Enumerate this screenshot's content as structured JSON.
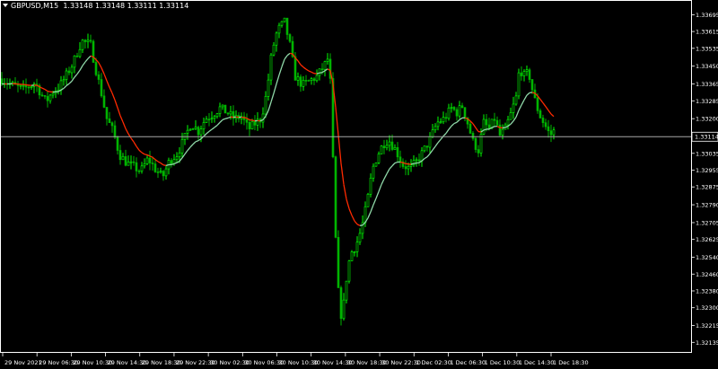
{
  "header": {
    "symbol": "GBPUSD,M15",
    "ohlc": "1.33148 1.33148 1.33111 1.33114"
  },
  "current_price": {
    "label": "1.33114",
    "value": 1.33114
  },
  "colors": {
    "background": "#000000",
    "frame": "#ffffff",
    "bull_candle": "#00ff00",
    "bear_candle": "#00b400",
    "ma_rising": "#8fd8a8",
    "ma_falling": "#ff2a00",
    "price_line": "#a8a8a8"
  },
  "chart_data": {
    "type": "line",
    "title": "",
    "xlabel": "",
    "ylabel": "",
    "ylim": [
      1.32085,
      1.33765
    ],
    "y_ticks": [
      "1.33695",
      "1.33615",
      "1.33535",
      "1.33450",
      "1.33365",
      "1.33285",
      "1.33200",
      "1.33120",
      "1.33035",
      "1.32955",
      "1.32875",
      "1.32790",
      "1.32705",
      "1.32625",
      "1.32540",
      "1.32460",
      "1.32380",
      "1.32300",
      "1.32215",
      "1.32135"
    ],
    "x_ticks": [
      "29 Nov 2021",
      "29 Nov 06:30",
      "29 Nov 10:30",
      "29 Nov 14:30",
      "29 Nov 18:30",
      "29 Nov 22:30",
      "30 Nov 02:30",
      "30 Nov 06:30",
      "30 Nov 10:30",
      "30 Nov 14:30",
      "30 Nov 18:30",
      "30 Nov 22:30",
      "1 Dec 02:30",
      "1 Dec 06:30",
      "1 Dec 10:30",
      "1 Dec 14:30",
      "1 Dec 18:30"
    ],
    "close_anchors": [
      [
        0,
        1.3339
      ],
      [
        12,
        1.3336
      ],
      [
        25,
        1.3334
      ],
      [
        38,
        1.3337
      ],
      [
        50,
        1.3328
      ],
      [
        58,
        1.3333
      ],
      [
        65,
        1.3335
      ],
      [
        72,
        1.334
      ],
      [
        80,
        1.3346
      ],
      [
        90,
        1.3357
      ],
      [
        100,
        1.3355
      ],
      [
        105,
        1.3345
      ],
      [
        112,
        1.3332
      ],
      [
        118,
        1.332
      ],
      [
        125,
        1.3314
      ],
      [
        132,
        1.3303
      ],
      [
        140,
        1.3299
      ],
      [
        148,
        1.3297
      ],
      [
        156,
        1.3295
      ],
      [
        164,
        1.3301
      ],
      [
        172,
        1.3296
      ],
      [
        180,
        1.3292
      ],
      [
        188,
        1.33
      ],
      [
        196,
        1.3303
      ],
      [
        204,
        1.331
      ],
      [
        212,
        1.3318
      ],
      [
        220,
        1.3314
      ],
      [
        228,
        1.332
      ],
      [
        236,
        1.3322
      ],
      [
        244,
        1.3325
      ],
      [
        252,
        1.3323
      ],
      [
        260,
        1.332
      ],
      [
        268,
        1.3321
      ],
      [
        276,
        1.3315
      ],
      [
        284,
        1.3318
      ],
      [
        290,
        1.332
      ],
      [
        296,
        1.3332
      ],
      [
        302,
        1.3352
      ],
      [
        308,
        1.3362
      ],
      [
        316,
        1.3366
      ],
      [
        322,
        1.3355
      ],
      [
        328,
        1.334
      ],
      [
        336,
        1.3336
      ],
      [
        344,
        1.3338
      ],
      [
        352,
        1.334
      ],
      [
        360,
        1.3345
      ],
      [
        366,
        1.335
      ],
      [
        370,
        1.33
      ],
      [
        374,
        1.325
      ],
      [
        378,
        1.3225
      ],
      [
        382,
        1.3232
      ],
      [
        386,
        1.3248
      ],
      [
        390,
        1.3256
      ],
      [
        396,
        1.326
      ],
      [
        402,
        1.3268
      ],
      [
        408,
        1.328
      ],
      [
        414,
        1.3296
      ],
      [
        420,
        1.3303
      ],
      [
        426,
        1.3308
      ],
      [
        432,
        1.331
      ],
      [
        440,
        1.3305
      ],
      [
        448,
        1.3298
      ],
      [
        456,
        1.3296
      ],
      [
        464,
        1.33
      ],
      [
        470,
        1.3304
      ],
      [
        478,
        1.331
      ],
      [
        486,
        1.3318
      ],
      [
        494,
        1.332
      ],
      [
        502,
        1.3325
      ],
      [
        508,
        1.3323
      ],
      [
        514,
        1.3326
      ],
      [
        520,
        1.3318
      ],
      [
        526,
        1.3309
      ],
      [
        532,
        1.3305
      ],
      [
        538,
        1.3318
      ],
      [
        544,
        1.3315
      ],
      [
        550,
        1.332
      ],
      [
        556,
        1.3312
      ],
      [
        562,
        1.3315
      ],
      [
        568,
        1.3322
      ],
      [
        574,
        1.333
      ],
      [
        578,
        1.3345
      ],
      [
        582,
        1.334
      ],
      [
        588,
        1.3342
      ],
      [
        594,
        1.333
      ],
      [
        600,
        1.3322
      ],
      [
        606,
        1.3317
      ],
      [
        612,
        1.3312
      ],
      [
        616,
        1.3314
      ]
    ],
    "series": [
      {
        "name": "",
        "kind": "candles",
        "timeframe": "M15"
      },
      {
        "name": "",
        "kind": "moving-average"
      }
    ],
    "grid": false
  }
}
